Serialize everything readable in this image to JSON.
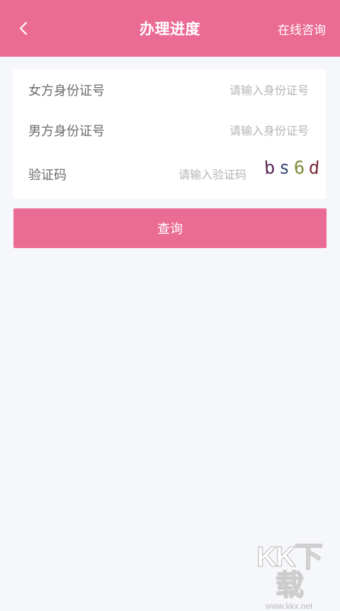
{
  "header": {
    "title": "办理进度",
    "right_action": "在线咨询",
    "background_color": "#ea6b93",
    "back_icon": "chevron-left-icon"
  },
  "form": {
    "female_id": {
      "label": "女方身份证号",
      "placeholder": "请输入身份证号",
      "value": ""
    },
    "male_id": {
      "label": "男方身份证号",
      "placeholder": "请输入身份证号",
      "value": ""
    },
    "captcha": {
      "label": "验证码",
      "placeholder": "请输入验证码",
      "value": "",
      "image_chars": [
        "b",
        "s",
        "6",
        "d"
      ]
    }
  },
  "query_button": {
    "label": "查询"
  },
  "watermark": {
    "logo": "KK下载",
    "url": "www.kkx.net"
  }
}
